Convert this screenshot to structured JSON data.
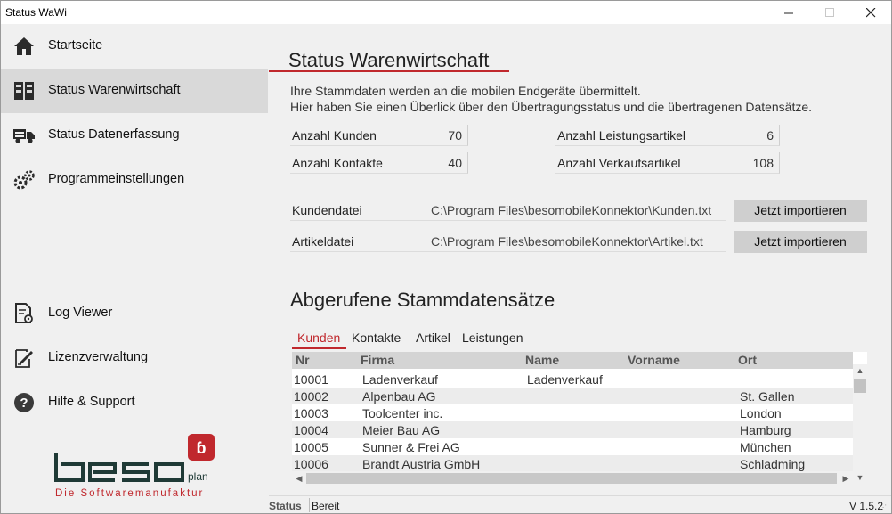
{
  "window": {
    "title": "Status WaWi"
  },
  "sidebar": {
    "top_items": [
      {
        "label": "Startseite",
        "icon": "home-icon",
        "active": false
      },
      {
        "label": "Status Warenwirtschaft",
        "icon": "warehouse-icon",
        "active": true
      },
      {
        "label": "Status Datenerfassung",
        "icon": "truck-icon",
        "active": false
      },
      {
        "label": "Programmeinstellungen",
        "icon": "gears-icon",
        "active": false
      }
    ],
    "bottom_items": [
      {
        "label": "Log Viewer",
        "icon": "log-icon"
      },
      {
        "label": "Lizenzverwaltung",
        "icon": "license-icon"
      },
      {
        "label": "Hilfe & Support",
        "icon": "help-icon"
      }
    ],
    "logo": {
      "text": "beso",
      "suffix": "plan",
      "tagline": "Die Softwaremanufaktur",
      "color": "#c0282d",
      "dark": "#1f3a36"
    }
  },
  "main": {
    "title": "Status Warenwirtschaft",
    "intro_line1": "Ihre Stammdaten werden an die mobilen Endgeräte übermittelt.",
    "intro_line2": "Hier haben Sie einen Überlick über den Übertragungsstatus und die übertragenen Datensätze.",
    "stats": {
      "kunden_label": "Anzahl Kunden",
      "kunden_value": "70",
      "kontakte_label": "Anzahl Kontakte",
      "kontakte_value": "40",
      "leistung_label": "Anzahl Leistungsartikel",
      "leistung_value": "6",
      "verkauf_label": "Anzahl Verkaufsartikel",
      "verkauf_value": "108"
    },
    "files": {
      "kunden_label": "Kundendatei",
      "kunden_path": "C:\\Program Files\\besomobileKonnektor\\Kunden.txt",
      "artikel_label": "Artikeldatei",
      "artikel_path": "C:\\Program Files\\besomobileKonnektor\\Artikel.txt",
      "import_label": "Jetzt importieren"
    },
    "section_title": "Abgerufene Stammdatensätze",
    "tabs": [
      "Kunden",
      "Kontakte",
      "Artikel",
      "Leistungen"
    ],
    "active_tab": "Kunden",
    "table": {
      "columns": [
        "Nr",
        "Firma",
        "Name",
        "Vorname",
        "Ort"
      ],
      "rows": [
        [
          "10001",
          "Ladenverkauf",
          "Ladenverkauf",
          "",
          ""
        ],
        [
          "10002",
          "Alpenbau AG",
          "",
          "",
          "St. Gallen"
        ],
        [
          "10003",
          "Toolcenter inc.",
          "",
          "",
          "London"
        ],
        [
          "10004",
          "Meier Bau AG",
          "",
          "",
          "Hamburg"
        ],
        [
          "10005",
          "Sunner & Frei AG",
          "",
          "",
          "München"
        ],
        [
          "10006",
          "Brandt Austria GmbH",
          "",
          "",
          "Schladming"
        ]
      ]
    }
  },
  "statusbar": {
    "label": "Status",
    "value": "Bereit",
    "version": "V 1.5.2"
  },
  "colors": {
    "accent": "#c0282d",
    "active_nav": "#d9d9d9",
    "header_bg": "#d4d4d4"
  }
}
